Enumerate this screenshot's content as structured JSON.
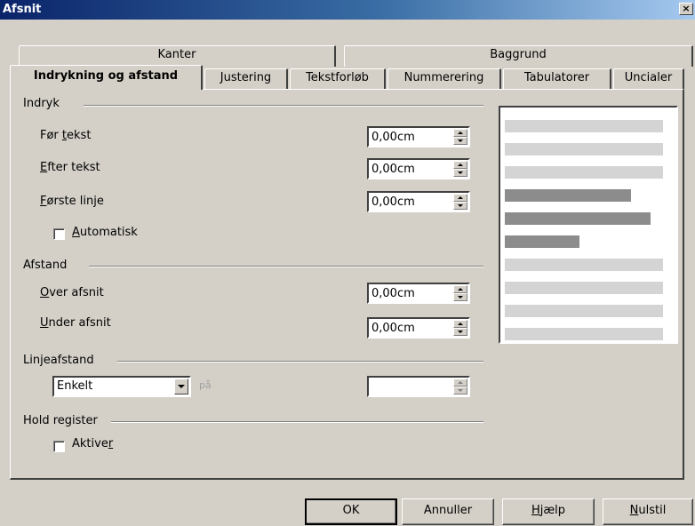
{
  "window": {
    "title": "Afsnit",
    "close_glyph": "×"
  },
  "tabs_row1": [
    {
      "label": "Kanter"
    },
    {
      "label": "Baggrund"
    }
  ],
  "tabs_row2": [
    {
      "label": "Indrykning og afstand",
      "active": true
    },
    {
      "label": "Justering"
    },
    {
      "label": "Tekstforløb"
    },
    {
      "label": "Nummerering"
    },
    {
      "label": "Tabulatorer"
    },
    {
      "label": "Uncialer"
    }
  ],
  "indent": {
    "title": "Indryk",
    "before": {
      "pre": "Før ",
      "key": "t",
      "post": "ekst",
      "value": "0,00cm"
    },
    "after": {
      "pre": "",
      "key": "E",
      "post": "fter tekst",
      "value": "0,00cm"
    },
    "first": {
      "pre": "",
      "key": "F",
      "post": "ørste linje",
      "value": "0,00cm"
    },
    "auto": {
      "pre": "",
      "key": "A",
      "post": "utomatisk",
      "checked": false
    }
  },
  "spacing": {
    "title": "Afstand",
    "above": {
      "pre": "",
      "key": "O",
      "post": "ver afsnit",
      "value": "0,00cm"
    },
    "below": {
      "pre": "",
      "key": "U",
      "post": "nder afsnit",
      "value": "0,00cm"
    }
  },
  "linespacing": {
    "title": "Linjeafstand",
    "selected": "Enkelt",
    "of_label": "på",
    "value": ""
  },
  "register": {
    "title": "Hold register",
    "activate": {
      "pre": "Aktive",
      "key": "r",
      "post": "",
      "checked": false
    }
  },
  "preview": {
    "bars": [
      {
        "width": 0.98,
        "shade": "light"
      },
      {
        "width": 0.98,
        "shade": "light"
      },
      {
        "width": 0.98,
        "shade": "light"
      },
      {
        "width": 0.78,
        "shade": "dark"
      },
      {
        "width": 0.9,
        "shade": "dark"
      },
      {
        "width": 0.46,
        "shade": "dark"
      },
      {
        "width": 0.98,
        "shade": "light"
      },
      {
        "width": 0.98,
        "shade": "light"
      },
      {
        "width": 0.98,
        "shade": "light"
      },
      {
        "width": 0.98,
        "shade": "light"
      }
    ],
    "colors": {
      "light": "#d4d4d4",
      "dark": "#8c8c8c"
    }
  },
  "buttons": {
    "ok": {
      "label": "OK"
    },
    "cancel": {
      "label": "Annuller"
    },
    "help": {
      "pre": "",
      "key": "H",
      "post": "jælp"
    },
    "reset": {
      "pre": "",
      "key": "N",
      "post": "ulstil"
    }
  }
}
